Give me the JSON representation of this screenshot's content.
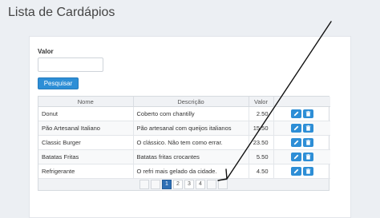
{
  "page": {
    "title": "Lista de Cardápios"
  },
  "filter": {
    "label": "Valor",
    "value": "",
    "placeholder": "",
    "search_label": "Pesquisar"
  },
  "table": {
    "headers": [
      "Nome",
      "Descrição",
      "Valor",
      ""
    ],
    "rows": [
      {
        "nome": "Donut",
        "descricao": "Coberto com chantilly",
        "valor": "2.50"
      },
      {
        "nome": "Pão Artesanal Italiano",
        "descricao": "Pão artesanal com queijos italianos",
        "valor": "15.50"
      },
      {
        "nome": "Classic Burger",
        "descricao": "O clássico. Não tem como errar.",
        "valor": "23.50"
      },
      {
        "nome": "Batatas Fritas",
        "descricao": "Batatas fritas crocantes",
        "valor": "5.50"
      },
      {
        "nome": "Refrigerante",
        "descricao": "O refri mais gelado da cidade.",
        "valor": "4.50"
      }
    ]
  },
  "pagination": {
    "pages": [
      "1",
      "2",
      "3",
      "4"
    ],
    "current": "1"
  },
  "icons": {
    "edit": "pencil-icon",
    "delete": "trash-icon",
    "accent": "#2d8ed6"
  }
}
